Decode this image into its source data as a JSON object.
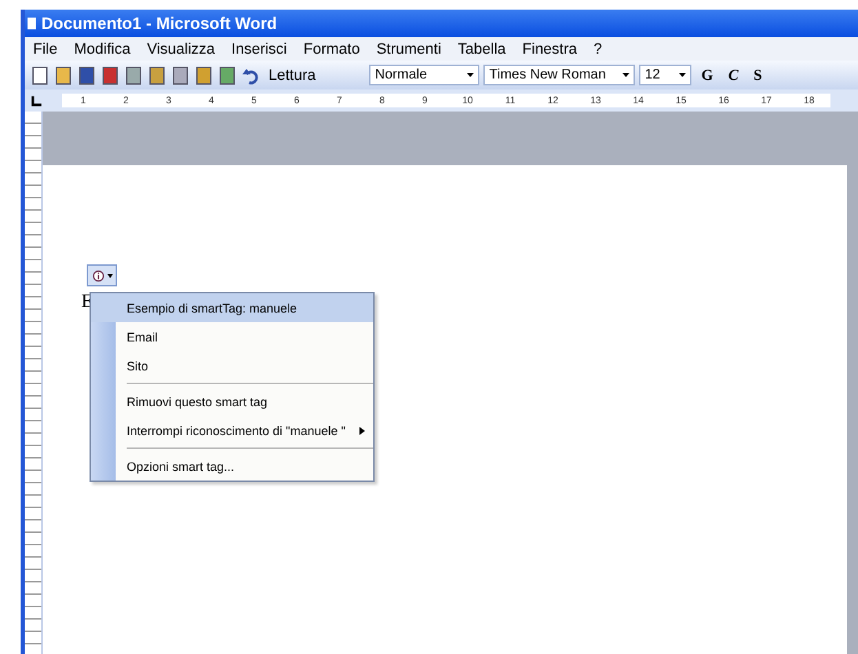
{
  "window": {
    "title": "Documento1 - Microsoft Word"
  },
  "menu_bar": [
    "File",
    "Modifica",
    "Visualizza",
    "Inserisci",
    "Formato",
    "Strumenti",
    "Tabella",
    "Finestra",
    "?"
  ],
  "toolbar": {
    "reading_button": "Lettura",
    "style": "Normale",
    "font": "Times New Roman",
    "size": "12",
    "format_buttons": [
      "G",
      "C",
      "S"
    ]
  },
  "ruler": [
    "1",
    "2",
    "3",
    "4",
    "5",
    "6",
    "7",
    "8",
    "9",
    "10",
    "11",
    "12",
    "13",
    "14",
    "15",
    "16",
    "17",
    "18"
  ],
  "document": {
    "text": "E"
  },
  "smart_tag_menu": {
    "items": [
      {
        "kind": "item",
        "label": "Esempio di smartTag: manuele",
        "selected": true,
        "submenu": false
      },
      {
        "kind": "item",
        "label": "Email",
        "selected": false,
        "submenu": false
      },
      {
        "kind": "item",
        "label": "Sito",
        "selected": false,
        "submenu": false
      },
      {
        "kind": "separator"
      },
      {
        "kind": "item",
        "label": "Rimuovi questo smart tag",
        "selected": false,
        "submenu": false
      },
      {
        "kind": "item",
        "label": "Interrompi riconoscimento di \"manuele \"",
        "selected": false,
        "submenu": true
      },
      {
        "kind": "separator"
      },
      {
        "kind": "item",
        "label": "Opzioni smart tag...",
        "selected": false,
        "submenu": false
      }
    ]
  }
}
